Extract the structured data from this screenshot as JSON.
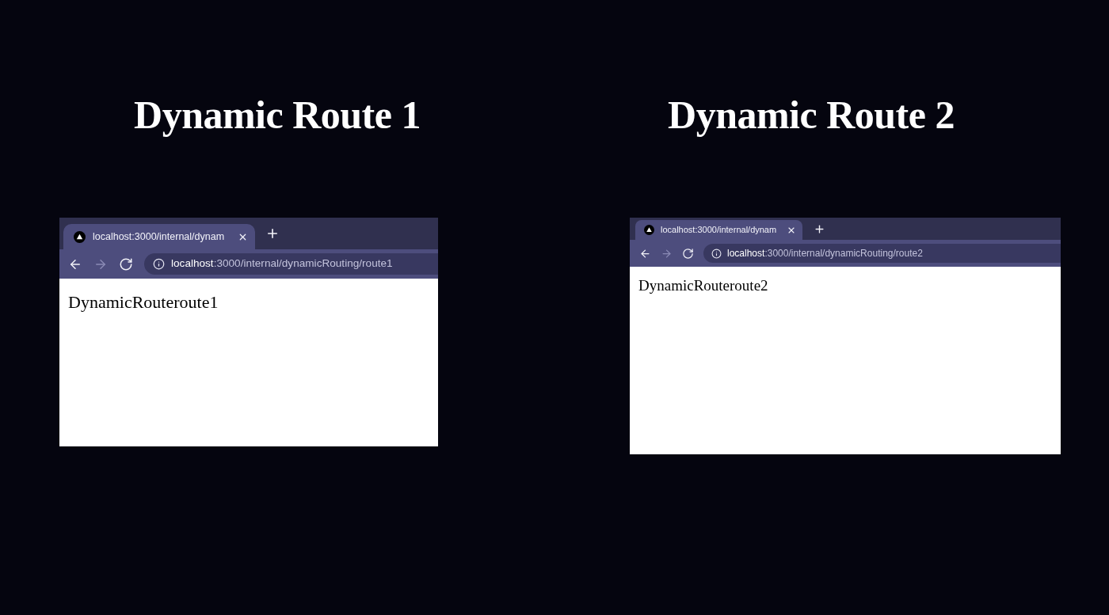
{
  "panels": [
    {
      "title": "Dynamic Route 1",
      "browser": {
        "tabs": [
          {
            "title": "localhost:3000/internal/dynam",
            "selected": true
          }
        ],
        "nav_buttons": [
          {
            "kind": "back",
            "disabled": false
          },
          {
            "kind": "forward",
            "disabled": true
          },
          {
            "kind": "reload",
            "disabled": false
          }
        ],
        "address": {
          "host": "localhost",
          "rest": ":3000/internal/dynamicRouting/route1"
        },
        "page_text": "DynamicRouteroute1"
      }
    },
    {
      "title": "Dynamic Route 2",
      "browser": {
        "tabs": [
          {
            "title": "localhost:3000/internal/dynam",
            "selected": true
          }
        ],
        "nav_buttons": [
          {
            "kind": "back",
            "disabled": false
          },
          {
            "kind": "forward",
            "disabled": true
          },
          {
            "kind": "reload",
            "disabled": false
          }
        ],
        "address": {
          "host": "localhost",
          "rest": ":3000/internal/dynamicRouting/route2"
        },
        "page_text": "DynamicRouteroute2"
      }
    }
  ]
}
